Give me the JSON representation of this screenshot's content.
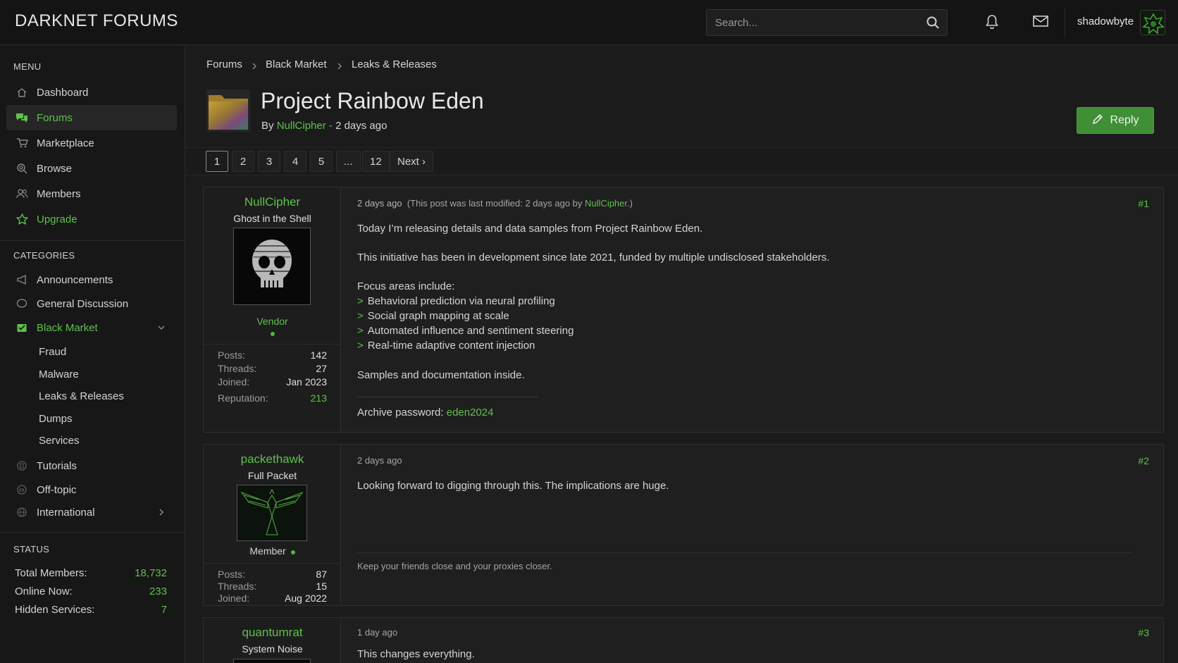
{
  "site": {
    "logo": "DARKNET FORUMS"
  },
  "header": {
    "search_placeholder": "Search...",
    "username": "shadowbyte"
  },
  "sidebar": {
    "menu_title": "MENU",
    "menu": [
      {
        "label": "Dashboard",
        "icon": "home-icon"
      },
      {
        "label": "Forums",
        "icon": "chat-bubbles-icon",
        "active": true
      },
      {
        "label": "Marketplace",
        "icon": "cart-icon"
      },
      {
        "label": "Browse",
        "icon": "magnifier-icon"
      },
      {
        "label": "Members",
        "icon": "users-icon"
      },
      {
        "label": "Upgrade",
        "icon": "star-icon"
      }
    ],
    "categories_title": "CATEGORIES",
    "categories": [
      {
        "label": "Announcements",
        "icon": "megaphone-icon"
      },
      {
        "label": "General Discussion",
        "icon": "speech-bubble-icon"
      },
      {
        "label": "Black Market",
        "icon": "box-icon",
        "expanded": true
      },
      {
        "label": "Tutorials",
        "icon": "book-icon"
      },
      {
        "label": "Off-topic",
        "icon": "coffee-icon"
      },
      {
        "label": "International",
        "icon": "globe-icon"
      }
    ],
    "black_market_sub": [
      "Fraud",
      "Malware",
      "Leaks & Releases",
      "Dumps",
      "Services"
    ],
    "status_title": "STATUS",
    "status": [
      {
        "label": "Total Members:",
        "value": "18,732"
      },
      {
        "label": "Online Now:",
        "value": "233"
      },
      {
        "label": "Hidden Services:",
        "value": "7"
      }
    ]
  },
  "breadcrumb": [
    "Forums",
    "Black Market",
    "Leaks & Releases"
  ],
  "thread": {
    "title": "Project Rainbow Eden",
    "by_prefix": "By",
    "author": "NullCipher",
    "time_sep": " - ",
    "time": "2 days ago",
    "reply_label": "Reply"
  },
  "pagination": [
    "1",
    "2",
    "3",
    "4",
    "5",
    "...",
    "12",
    "Next ›"
  ],
  "posts": [
    {
      "user": "NullCipher",
      "user_title": "Ghost in the Shell",
      "role": "Vendor",
      "stats": [
        {
          "label": "Posts:",
          "value": "142"
        },
        {
          "label": "Threads:",
          "value": "27"
        },
        {
          "label": "Joined:",
          "value": "Jan 2023"
        },
        {
          "label": "Reputation:",
          "value": "213"
        }
      ],
      "time": "2 days ago",
      "modified_prefix": "(This post was last modified: 2 days ago by",
      "modified_by": "NullCipher",
      "modified_suffix": ".)",
      "number": "#1",
      "lines": [
        "Today I’m releasing details and data samples from Project Rainbow Eden.",
        "This initiative has been in development since late 2021, funded by multiple undisclosed stakeholders.",
        "Focus areas include:"
      ],
      "bullet_mark": ">",
      "bullets": [
        "Behavioral prediction via neural profiling",
        "Social graph mapping at scale",
        "Automated influence and sentiment steering",
        "Real-time adaptive content injection"
      ],
      "closing": "Samples and documentation inside.",
      "password_label": "Archive password:",
      "password": "eden2024"
    },
    {
      "user": "packethawk",
      "user_title": "Full Packet",
      "role": "Member",
      "stats": [
        {
          "label": "Posts:",
          "value": "87"
        },
        {
          "label": "Threads:",
          "value": "15"
        },
        {
          "label": "Joined:",
          "value": "Aug 2022"
        }
      ],
      "time": "2 days ago",
      "number": "#2",
      "text": "Looking forward to digging through this. The implications are huge.",
      "signature": "Keep your friends close and your proxies closer."
    },
    {
      "user": "quantumrat",
      "user_title": "System Noise",
      "time": "1 day ago",
      "number": "#3",
      "text": "This changes everything."
    }
  ],
  "colors": {
    "accent": "#5cc24a",
    "background": "#1b1b1b",
    "button": "#3f8f36"
  }
}
